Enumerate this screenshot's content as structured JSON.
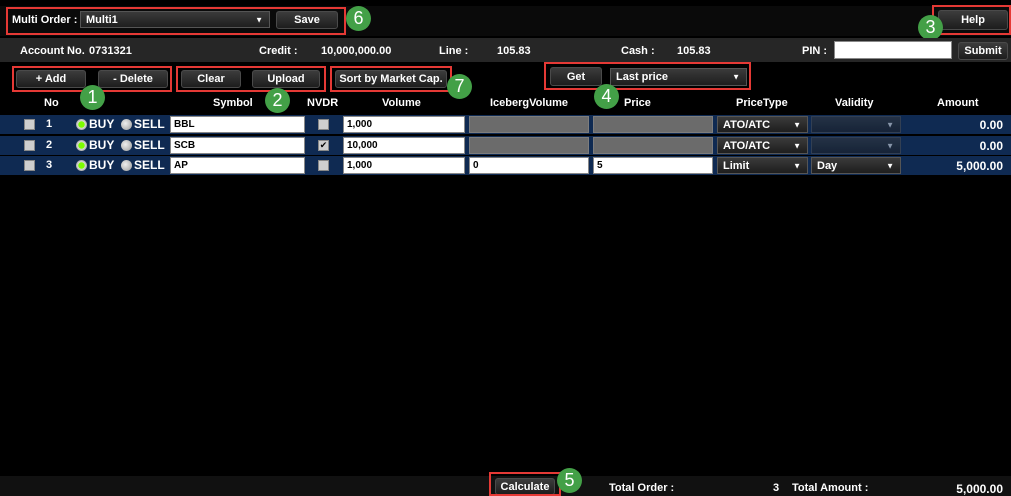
{
  "toolbar": {
    "multi_order_label": "Multi Order :",
    "multi_order_value": "Multi1",
    "save_label": "Save",
    "help_label": "Help"
  },
  "info": {
    "account_label": "Account No.",
    "account_no": "0731321",
    "credit_label": "Credit :",
    "credit_value": "10,000,000.00",
    "line_label": "Line :",
    "line_value": "105.83",
    "cash_label": "Cash :",
    "cash_value": "105.83",
    "pin_label": "PIN :",
    "pin_value": "",
    "submit_label": "Submit"
  },
  "actions": {
    "add_label": "+ Add",
    "delete_label": "- Delete",
    "clear_label": "Clear",
    "upload_label": "Upload",
    "sort_label": "Sort by Market Cap.",
    "get_label": "Get",
    "price_source": "Last price"
  },
  "columns": {
    "no": "No",
    "symbol": "Symbol",
    "nvdr": "NVDR",
    "volume": "Volume",
    "iceberg": "IcebergVolume",
    "price": "Price",
    "price_type": "PriceType",
    "validity": "Validity",
    "amount": "Amount"
  },
  "side_labels": {
    "buy": "BUY",
    "sell": "SELL"
  },
  "rows": [
    {
      "no": "1",
      "side": "BUY",
      "symbol": "BBL",
      "nvdr": false,
      "volume": "1,000",
      "iceberg": "",
      "price": "",
      "price_type": "ATO/ATC",
      "validity": "",
      "amount": "0.00"
    },
    {
      "no": "2",
      "side": "BUY",
      "symbol": "SCB",
      "nvdr": true,
      "volume": "10,000",
      "iceberg": "",
      "price": "",
      "price_type": "ATO/ATC",
      "validity": "",
      "amount": "0.00"
    },
    {
      "no": "3",
      "side": "BUY",
      "symbol": "AP",
      "nvdr": false,
      "volume": "1,000",
      "iceberg": "0",
      "price": "5",
      "price_type": "Limit",
      "validity": "Day",
      "amount": "5,000.00"
    }
  ],
  "footer": {
    "calculate_label": "Calculate",
    "total_order_label": "Total Order :",
    "total_order_value": "3",
    "total_amount_label": "Total Amount :",
    "total_amount_value": "5,000.00"
  },
  "callouts": [
    "1",
    "2",
    "3",
    "4",
    "5",
    "6",
    "7"
  ],
  "colors": {
    "highlight": "#e53935",
    "callout": "#43a047",
    "row_bg": "#0f2a52"
  }
}
